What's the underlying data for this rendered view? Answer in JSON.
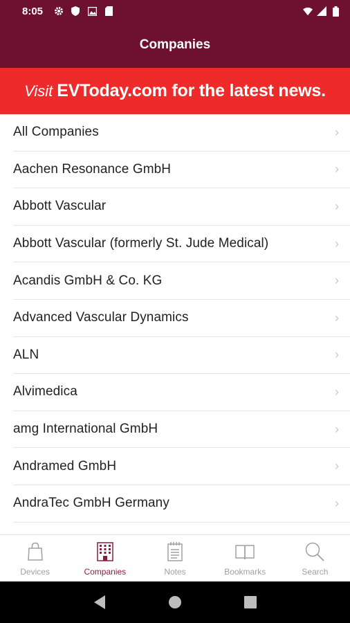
{
  "status_bar": {
    "time": "8:05"
  },
  "app_bar": {
    "title": "Companies"
  },
  "banner": {
    "visit": "Visit",
    "text": "EVToday.com for the latest news."
  },
  "companies": [
    "All Companies",
    "Aachen Resonance GmbH",
    "Abbott Vascular",
    "Abbott Vascular (formerly St. Jude Medical)",
    "Acandis GmbH & Co. KG",
    "Advanced Vascular Dynamics",
    "ALN",
    "Alvimedica",
    "amg International GmbH",
    "Andramed GmbH",
    "AndraTec GmbH Germany"
  ],
  "tabs": {
    "devices": "Devices",
    "companies": "Companies",
    "notes": "Notes",
    "bookmarks": "Bookmarks",
    "search": "Search"
  },
  "colors": {
    "header": "#6e1030",
    "banner": "#ef2a2a",
    "active_tab": "#8a1d3f",
    "inactive_tab": "#a0a0a0"
  }
}
